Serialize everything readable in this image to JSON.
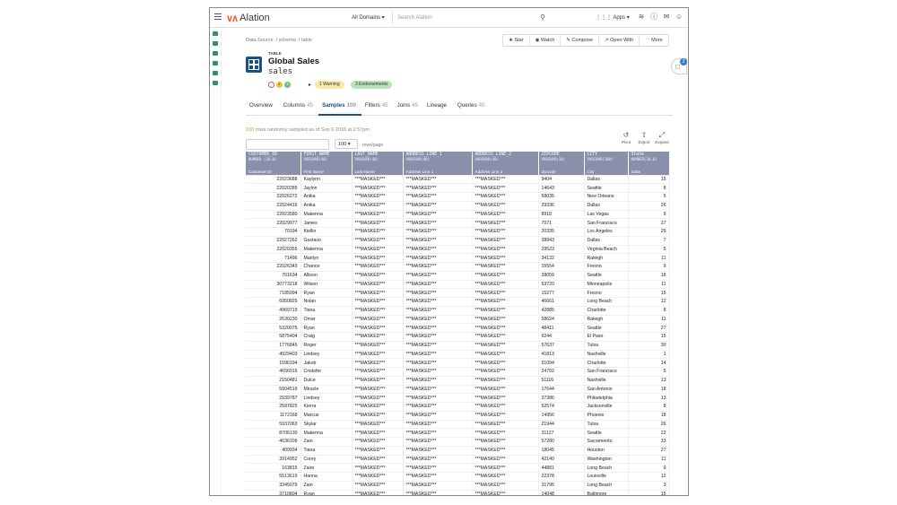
{
  "topbar": {
    "brand": "Alation",
    "domain_select": "All Domains",
    "search_placeholder": "Search Alation",
    "apps_label": "Apps"
  },
  "breadcrumb": [
    "Data Source",
    "schema",
    "table"
  ],
  "actions": [
    "Star",
    "Watch",
    "Compose",
    "Open With",
    "More"
  ],
  "header": {
    "object_type": "TABLE",
    "title": "Global Sales",
    "subtitle": "sales",
    "dot_labels": [
      "",
      "1",
      "3"
    ],
    "warning_badge": "1 Warning",
    "endorsement_badge": "3 Endorsements",
    "chat_count": "2"
  },
  "tabs": [
    {
      "label": "Overview",
      "count": ""
    },
    {
      "label": "Columns",
      "count": "45"
    },
    {
      "label": "Samples",
      "count": "100"
    },
    {
      "label": "Filters",
      "count": "45"
    },
    {
      "label": "Joins",
      "count": "45"
    },
    {
      "label": "Lineage",
      "count": ""
    },
    {
      "label": "Queries",
      "count": "45"
    }
  ],
  "samples": {
    "count": "100",
    "info_rest": " rows randomly sampled as of Sep 6 2018 at 2:57pm",
    "rows_per_page": "100",
    "rows_per_page_label": "rows/page",
    "tools": [
      "Pivot",
      "Export",
      "Expand"
    ]
  },
  "colors": {
    "accent": "#1b4f8a",
    "header_bg": "#8a8fab",
    "orange": "#e58b2a"
  },
  "table": {
    "columns": [
      {
        "name": "CUSTOMER_ID",
        "type": "NUMBER (38,0)",
        "title": "Customer ID"
      },
      {
        "name": "FIRST_NAME",
        "type": "VARCHAR(40)",
        "title": "First Name"
      },
      {
        "name": "LAST_NAME",
        "type": "VARCHAR(40)",
        "title": "Last Name"
      },
      {
        "name": "ADDRESS_LINE_1",
        "type": "VARCHAR(40)",
        "title": "Address Line 1"
      },
      {
        "name": "ADDRESS_LINE_2",
        "type": "VARCHAR(40)",
        "title": "Address Line 2"
      },
      {
        "name": "ZIPCODE",
        "type": "VARCHAR(10)",
        "title": "Zipcode"
      },
      {
        "name": "CITY",
        "type": "VARCHAR(100)",
        "title": "City"
      },
      {
        "name": "State",
        "type": "NUMBER(38,0)",
        "title": "State"
      }
    ],
    "rows": [
      [
        "22023688",
        "Kaylynn",
        "***MASKED***",
        "***MASKED***",
        "***MASKED***",
        "9404",
        "Dallas",
        "15"
      ],
      [
        "22020285",
        "Jaylon",
        "***MASKED***",
        "***MASKED***",
        "***MASKED***",
        "14643",
        "Seattle",
        "8"
      ],
      [
        "22026272",
        "Anika",
        "***MASKED***",
        "***MASKED***",
        "***MASKED***",
        "58035",
        "New Orleans",
        "5"
      ],
      [
        "22024416",
        "Anika",
        "***MASKED***",
        "***MASKED***",
        "***MASKED***",
        "29336",
        "Dallas",
        "26"
      ],
      [
        "22023580",
        "Makenna",
        "***MASKED***",
        "***MASKED***",
        "***MASKED***",
        "8918",
        "Las Vegas",
        "9"
      ],
      [
        "22029977",
        "James",
        "***MASKED***",
        "***MASKED***",
        "***MASKED***",
        "7071",
        "San Francisco",
        "27"
      ],
      [
        "70194",
        "Kiellin",
        "***MASKED***",
        "***MASKED***",
        "***MASKED***",
        "20335",
        "Los Angeles",
        "29"
      ],
      [
        "22027262",
        "Gustavo",
        "***MASKED***",
        "***MASKED***",
        "***MASKED***",
        "28843",
        "Dallas",
        "7"
      ],
      [
        "22020355",
        "Makenna",
        "***MASKED***",
        "***MASKED***",
        "***MASKED***",
        "29523",
        "Virginia Beach",
        "5"
      ],
      [
        "71496",
        "Marilyn",
        "***MASKED***",
        "***MASKED***",
        "***MASKED***",
        "34132",
        "Raleigh",
        "11"
      ],
      [
        "22026343",
        "Chance",
        "***MASKED***",
        "***MASKED***",
        "***MASKED***",
        "15554",
        "Fresno",
        "9"
      ],
      [
        "701634",
        "Allison",
        "***MASKED***",
        "***MASKED***",
        "***MASKED***",
        "38059",
        "Seattle",
        "18"
      ],
      [
        "30773218",
        "Wilson",
        "***MASKED***",
        "***MASKED***",
        "***MASKED***",
        "53720",
        "Minneapolis",
        "11"
      ],
      [
        "7185994",
        "Ryan",
        "***MASKED***",
        "***MASKED***",
        "***MASKED***",
        "15277",
        "Fresno",
        "15"
      ],
      [
        "6950825",
        "Nolan",
        "***MASKED***",
        "***MASKED***",
        "***MASKED***",
        "46661",
        "Long Beach",
        "12"
      ],
      [
        "4969719",
        "Tiana",
        "***MASKED***",
        "***MASKED***",
        "***MASKED***",
        "42885",
        "Charlotte",
        "8"
      ],
      [
        "2630230",
        "Omar",
        "***MASKED***",
        "***MASKED***",
        "***MASKED***",
        "58624",
        "Raleigh",
        "11"
      ],
      [
        "5320075",
        "Ryan",
        "***MASKED***",
        "***MASKED***",
        "***MASKED***",
        "48411",
        "Seattle",
        "27"
      ],
      [
        "5875404",
        "Craig",
        "***MASKED***",
        "***MASKED***",
        "***MASKED***",
        "6244",
        "El Paso",
        "15"
      ],
      [
        "1776845",
        "Roger",
        "***MASKED***",
        "***MASKED***",
        "***MASKED***",
        "57637",
        "Tulsa",
        "30"
      ],
      [
        "4929403",
        "Lindsey",
        "***MASKED***",
        "***MASKED***",
        "***MASKED***",
        "41813",
        "Nashville",
        "1"
      ],
      [
        "1596194",
        "Jakob",
        "***MASKED***",
        "***MASKED***",
        "***MASKED***",
        "51094",
        "Charlotte",
        "14"
      ],
      [
        "4656916",
        "Cristofer",
        "***MASKED***",
        "***MASKED***",
        "***MASKED***",
        "24792",
        "San Francisco",
        "5"
      ],
      [
        "2150481",
        "Dulce",
        "***MASKED***",
        "***MASKED***",
        "***MASKED***",
        "51116",
        "Nashville",
        "13"
      ],
      [
        "5904519",
        "Miracle",
        "***MASKED***",
        "***MASKED***",
        "***MASKED***",
        "17644",
        "San Antonio",
        "18"
      ],
      [
        "2939787",
        "Lindsey",
        "***MASKED***",
        "***MASKED***",
        "***MASKED***",
        "37386",
        "Philadelphia",
        "13"
      ],
      [
        "2597825",
        "Kierra",
        "***MASKED***",
        "***MASKED***",
        "***MASKED***",
        "52574",
        "Jacksonville",
        "8"
      ],
      [
        "1172168",
        "Marcus",
        "***MASKED***",
        "***MASKED***",
        "***MASKED***",
        "14956",
        "Phoenix",
        "18"
      ],
      [
        "5937063",
        "Skylar",
        "***MASKED***",
        "***MASKED***",
        "***MASKED***",
        "21944",
        "Tulsa",
        "26"
      ],
      [
        "8706130",
        "Makenna",
        "***MASKED***",
        "***MASKED***",
        "***MASKED***",
        "31127",
        "Seattle",
        "22"
      ],
      [
        "4636109",
        "Zain",
        "***MASKED***",
        "***MASKED***",
        "***MASKED***",
        "57280",
        "Sacramento",
        "33"
      ],
      [
        "409934",
        "Tiana",
        "***MASKED***",
        "***MASKED***",
        "***MASKED***",
        "18045",
        "Houston",
        "27"
      ],
      [
        "3914952",
        "Corey",
        "***MASKED***",
        "***MASKED***",
        "***MASKED***",
        "42140",
        "Washington",
        "11"
      ],
      [
        "163815",
        "Zaire",
        "***MASKED***",
        "***MASKED***",
        "***MASKED***",
        "44881",
        "Long Beach",
        "9"
      ],
      [
        "5513619",
        "Hanna",
        "***MASKED***",
        "***MASKED***",
        "***MASKED***",
        "22378",
        "Louisville",
        "12"
      ],
      [
        "3345079",
        "Zain",
        "***MASKED***",
        "***MASKED***",
        "***MASKED***",
        "31795",
        "Long Beach",
        "3"
      ],
      [
        "3710804",
        "Ryan",
        "***MASKED***",
        "***MASKED***",
        "***MASKED***",
        "14048",
        "Baltimore",
        "15"
      ]
    ]
  }
}
